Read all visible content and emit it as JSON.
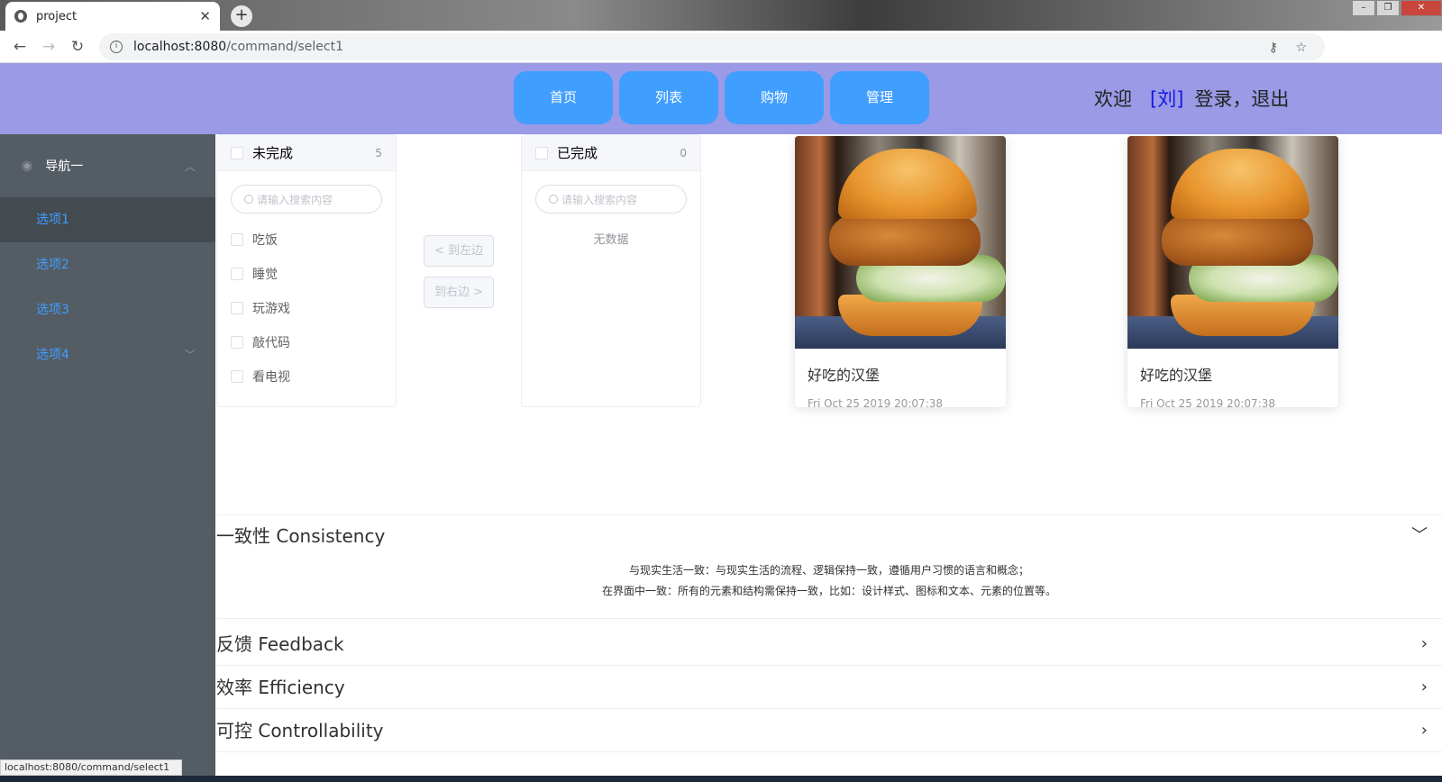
{
  "browser": {
    "tab_title": "project",
    "url_host": "localhost:8080",
    "url_path": "/command/select1",
    "status_url": "localhost:8080/command/select1"
  },
  "header": {
    "menu": [
      "首页",
      "列表",
      "购物",
      "管理"
    ],
    "welcome": "欢迎",
    "user": "[刘]",
    "login": "登录，",
    "logout": "退出",
    "bg_color": "#9a9ae6",
    "button_color": "#409eff"
  },
  "sidebar": {
    "title": "导航一",
    "items": [
      "选项1",
      "选项2",
      "选项3",
      "选项4"
    ],
    "active_index": 0
  },
  "transfer": {
    "left": {
      "title": "未完成",
      "count": "5",
      "placeholder": "请输入搜索内容",
      "items": [
        "吃饭",
        "睡觉",
        "玩游戏",
        "敲代码",
        "看电视"
      ]
    },
    "right": {
      "title": "已完成",
      "count": "0",
      "placeholder": "请输入搜索内容",
      "empty": "无数据"
    },
    "to_left": "< 到左边",
    "to_right": "到右边 >"
  },
  "cards": [
    {
      "title": "好吃的汉堡",
      "date": "Fri Oct 25 2019 20:07:38"
    },
    {
      "title": "好吃的汉堡",
      "date": "Fri Oct 25 2019 20:07:38"
    }
  ],
  "collapse": [
    {
      "title": "一致性 Consistency",
      "expanded": true,
      "lines": [
        "与现实生活一致：与现实生活的流程、逻辑保持一致，遵循用户习惯的语言和概念；",
        "在界面中一致：所有的元素和结构需保持一致，比如：设计样式、图标和文本、元素的位置等。"
      ]
    },
    {
      "title": "反馈 Feedback",
      "expanded": false
    },
    {
      "title": "效率 Efficiency",
      "expanded": false
    },
    {
      "title": "可控 Controllability",
      "expanded": false
    }
  ]
}
